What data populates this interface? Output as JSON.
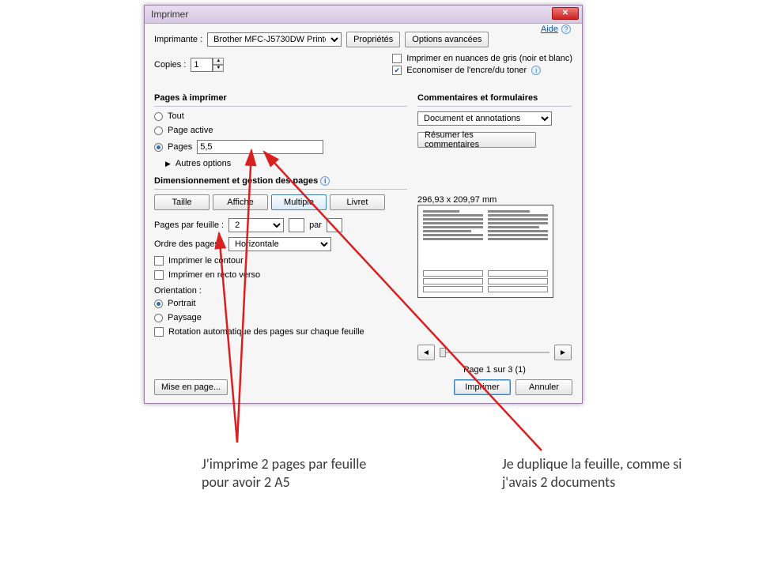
{
  "dialog": {
    "title": "Imprimer",
    "help": "Aide",
    "printer_label": "Imprimante :",
    "printer_value": "Brother MFC-J5730DW Printer",
    "properties_btn": "Propriétés",
    "advanced_btn": "Options avancées",
    "copies_label": "Copies :",
    "copies_value": "1",
    "grayscale_label": "Imprimer en nuances de gris (noir et blanc)",
    "save_ink_label": "Economiser de l'encre/du toner"
  },
  "pages": {
    "section": "Pages à imprimer",
    "all": "Tout",
    "current": "Page active",
    "pages_label": "Pages",
    "pages_value": "5,5",
    "more": "Autres options"
  },
  "comments": {
    "section": "Commentaires et formulaires",
    "select_value": "Document et annotations",
    "summarize_btn": "Résumer les commentaires"
  },
  "sizing": {
    "section": "Dimensionnement et gestion des pages",
    "tabs": {
      "size": "Taille",
      "poster": "Affiche",
      "multiple": "Multiple",
      "booklet": "Livret"
    },
    "per_sheet_label": "Pages par feuille :",
    "per_sheet_value": "2",
    "by": "par",
    "order_label": "Ordre des pages :",
    "order_value": "Horizontale",
    "print_border": "Imprimer le contour",
    "duplex": "Imprimer en recto verso"
  },
  "orientation": {
    "section": "Orientation :",
    "portrait": "Portrait",
    "landscape": "Paysage",
    "autorotate": "Rotation automatique des pages sur chaque feuille"
  },
  "preview": {
    "dim": "296,93 x 209,97 mm",
    "page_counter": "Page 1 sur 3 (1)"
  },
  "footer": {
    "page_setup": "Mise en page...",
    "print": "Imprimer",
    "cancel": "Annuler"
  },
  "annotations": {
    "left": "J'imprime 2 pages par feuille pour avoir 2 A5",
    "right": "Je duplique la feuille, comme si j'avais 2 documents"
  }
}
